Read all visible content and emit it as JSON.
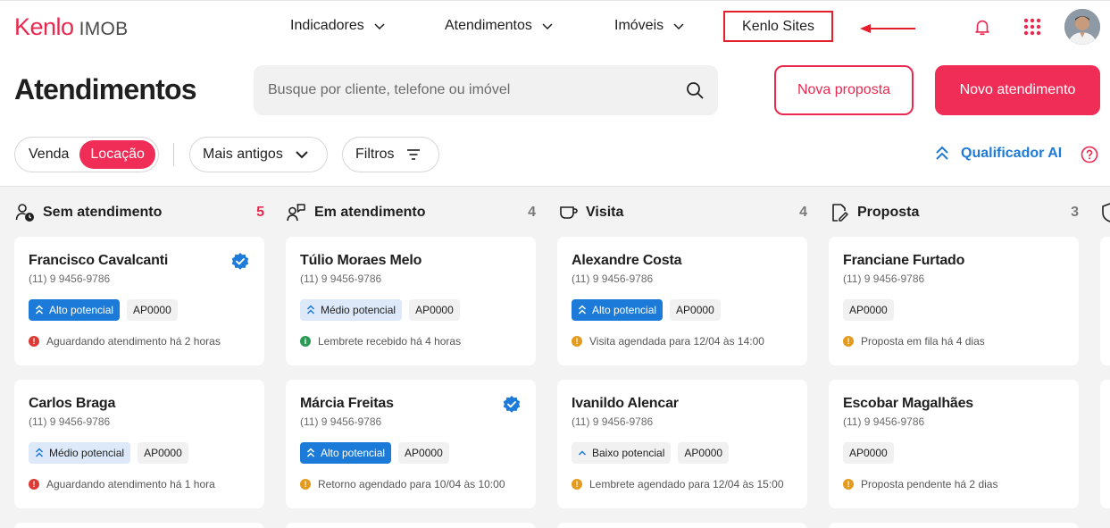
{
  "brand": {
    "name": "Kenlo",
    "product": "IMOB",
    "color": "#e9294f"
  },
  "nav": {
    "items": [
      {
        "label": "Indicadores"
      },
      {
        "label": "Atendimentos"
      },
      {
        "label": "Imóveis"
      }
    ],
    "highlighted": {
      "label": "Kenlo Sites"
    }
  },
  "header": {
    "title": "Atendimentos",
    "search_placeholder": "Busque por cliente, telefone ou imóvel",
    "new_proposal": "Nova proposta",
    "new_attendance": "Novo atendimento"
  },
  "filters": {
    "segment": [
      "Venda",
      "Locação"
    ],
    "segment_selected": "Locação",
    "sort_label": "Mais antigos",
    "filters_label": "Filtros",
    "ai_label": "Qualificador AI"
  },
  "columns": [
    {
      "title": "Sem atendimento",
      "count": "5",
      "icon": "person-clock-icon",
      "cards": [
        {
          "name": "Francisco Cavalcanti",
          "phone": "(11) 9 9456-9786",
          "verified": true,
          "potential": "Alto potencial",
          "level": "alto",
          "code": "AP0000",
          "status": "Aguardando atendimento há 2 horas",
          "status_color": "red"
        },
        {
          "name": "Carlos Braga",
          "phone": "(11) 9 9456-9786",
          "verified": false,
          "potential": "Médio potencial",
          "level": "medio",
          "code": "AP0000",
          "status": "Aguardando atendimento há 1 hora",
          "status_color": "red"
        }
      ]
    },
    {
      "title": "Em atendimento",
      "count": "4",
      "icon": "chat-person-icon",
      "cards": [
        {
          "name": "Túlio Moraes Melo",
          "phone": "(11) 9 9456-9786",
          "verified": false,
          "potential": "Médio potencial",
          "level": "medio",
          "code": "AP0000",
          "status": "Lembrete recebido há 4 horas",
          "status_color": "green"
        },
        {
          "name": "Márcia Freitas",
          "phone": "(11) 9 9456-9786",
          "verified": true,
          "potential": "Alto potencial",
          "level": "alto",
          "code": "AP0000",
          "status": "Retorno agendado para 10/04 às 10:00",
          "status_color": "orange"
        }
      ]
    },
    {
      "title": "Visita",
      "count": "4",
      "icon": "cup-icon",
      "cards": [
        {
          "name": "Alexandre Costa",
          "phone": "(11) 9 9456-9786",
          "verified": false,
          "potential": "Alto potencial",
          "level": "alto",
          "code": "AP0000",
          "status": "Visita agendada para 12/04 às 14:00",
          "status_color": "orange"
        },
        {
          "name": "Ivanildo Alencar",
          "phone": "(11) 9 9456-9786",
          "verified": false,
          "potential": "Baixo potencial",
          "level": "baixo",
          "code": "AP0000",
          "status": "Lembrete agendado para 12/04 às 15:00",
          "status_color": "orange"
        }
      ]
    },
    {
      "title": "Proposta",
      "count": "3",
      "icon": "document-edit-icon",
      "cards": [
        {
          "name": "Franciane Furtado",
          "phone": "(11) 9 9456-9786",
          "verified": false,
          "potential": "",
          "level": "none",
          "code": "AP0000",
          "status": "Proposta em fila há 4 dias",
          "status_color": "orange"
        },
        {
          "name": "Escobar Magalhães",
          "phone": "(11) 9 9456-9786",
          "verified": false,
          "potential": "",
          "level": "none",
          "code": "AP0000",
          "status": "Proposta pendente há 2 dias",
          "status_color": "orange"
        }
      ]
    }
  ]
}
